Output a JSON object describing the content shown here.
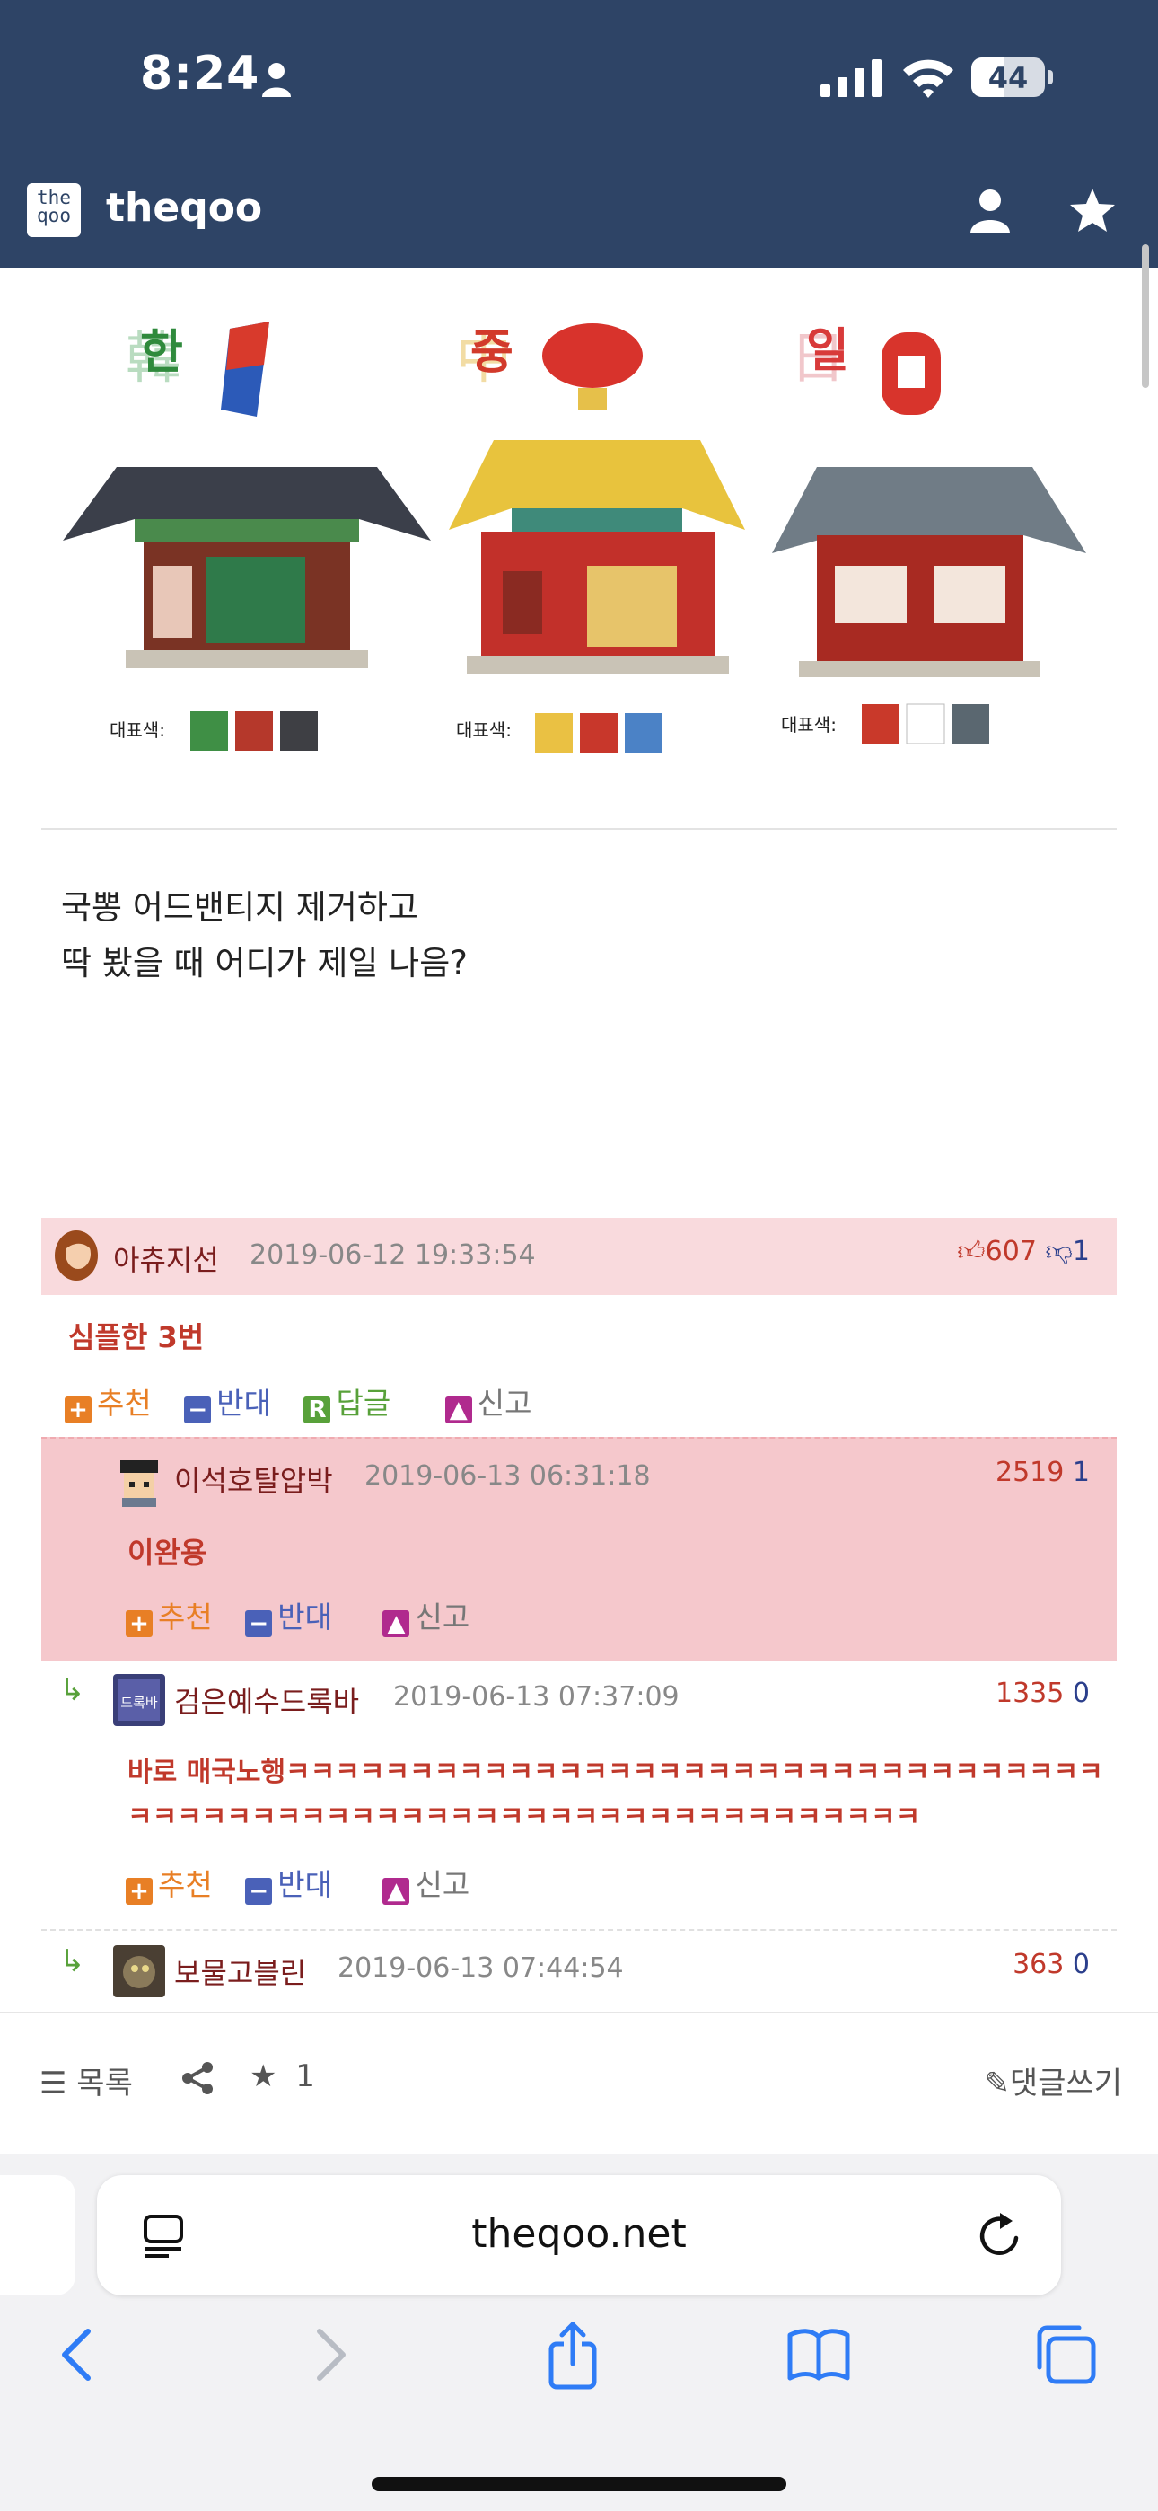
{
  "status_bar": {
    "time": "8:24",
    "battery": "44",
    "battery_level": 0.44
  },
  "header": {
    "logo_text_top": "the",
    "logo_text_bottom": "qoo",
    "site_name": "theqoo"
  },
  "illustration": {
    "houses": [
      {
        "title": "한",
        "hanja": "韓",
        "legend_label": "대표색:",
        "colors": [
          "#3f8f45",
          "#b5382b",
          "#3e3f44"
        ]
      },
      {
        "title": "중",
        "hanja": "中",
        "legend_label": "대표색:",
        "colors": [
          "#eac143",
          "#c8372b",
          "#4b82c6"
        ]
      },
      {
        "title": "일",
        "hanja": "日",
        "legend_label": "대표색:",
        "colors": [
          "#c9392a",
          "#ffffff",
          "#5a6770"
        ]
      }
    ]
  },
  "post": {
    "line1": "국뽕 어드밴티지 제거하고",
    "line2": "딱 봤을 때 어디가 제일 나음?"
  },
  "comments": [
    {
      "author": "아츄지선",
      "date": "2019-06-12 19:33:54",
      "up": "607",
      "down": "1",
      "body": "심플한 3번",
      "actions": {
        "recommend": "추천",
        "oppose": "반대",
        "reply": "답글",
        "report": "신고"
      }
    },
    {
      "author": "이석호탈압박",
      "date": "2019-06-13 06:31:18",
      "up": "2519",
      "down": "1",
      "body": "이완용",
      "actions": {
        "recommend": "추천",
        "oppose": "반대",
        "report": "신고"
      }
    },
    {
      "author": "검은예수드록바",
      "date": "2019-06-13 07:37:09",
      "up": "1335",
      "down": "0",
      "body1": "바로 매국노행ㅋㅋㅋㅋㅋㅋㅋㅋㅋㅋㅋㅋㅋㅋㅋㅋㅋㅋㅋㅋㅋㅋㅋㅋㅋㅋㅋㅋㅋㅋㅋㅋㅋ",
      "body2": "ㅋㅋㅋㅋㅋㅋㅋㅋㅋㅋㅋㅋㅋㅋㅋㅋㅋㅋㅋㅋㅋㅋㅋㅋㅋㅋㅋㅋㅋㅋㅋㅋ",
      "avatar_text": "드록바",
      "actions": {
        "recommend": "추천",
        "oppose": "반대",
        "report": "신고"
      }
    },
    {
      "author": "보물고블린",
      "date": "2019-06-13 07:44:54",
      "up": "363",
      "down": "0"
    }
  ],
  "board_bar": {
    "list_label": "목록",
    "star_count": "1",
    "write_label": "댓글쓰기"
  },
  "safari": {
    "url": "theqoo.net"
  }
}
